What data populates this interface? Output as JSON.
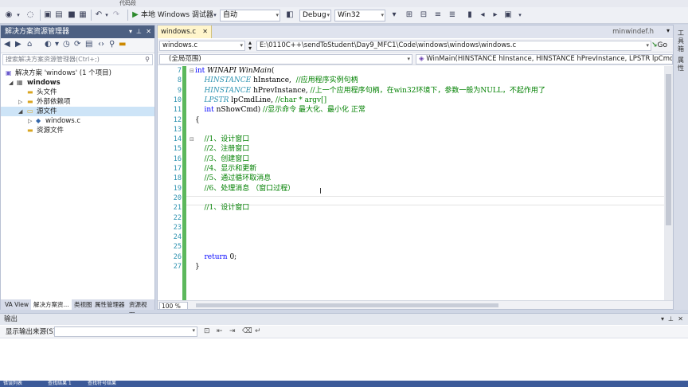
{
  "toolbar": {
    "menu_fragment": "代码段",
    "debug_target": "本地 Windows 调试器",
    "mode_combo": "自动",
    "config_combo": "Debug",
    "platform_combo": "Win32"
  },
  "solution_explorer": {
    "title": "解决方案资源管理器",
    "search_placeholder": "搜索解决方案资源管理器(Ctrl+;)",
    "tree": [
      {
        "label": "解决方案 'windows' (1 个项目)",
        "icon": "solution-icon"
      },
      {
        "label": "windows",
        "icon": "project-icon"
      },
      {
        "label": "头文件",
        "icon": "folder-icon"
      },
      {
        "label": "外部依赖项",
        "icon": "folder-icon"
      },
      {
        "label": "源文件",
        "icon": "folder-open-icon"
      },
      {
        "label": "windows.c",
        "icon": "c-file-icon"
      },
      {
        "label": "资源文件",
        "icon": "folder-icon"
      }
    ],
    "bottom_tabs": [
      "VA View",
      "解决方案资...",
      "类视图",
      "属性管理器",
      "资源视图"
    ]
  },
  "editor": {
    "active_tab": "windows.c",
    "right_tab_label": "minwindef.h",
    "file_combo": "windows.c",
    "path_combo": "E:\\0110C++\\sendToStudent\\Day9_MFC1\\Code\\windows\\windows\\windows.c",
    "go_label": "Go",
    "scope_combo": "(全局范围)",
    "function_combo": "WinMain(HINSTANCE hInstance, HINSTANCE hPrevInstance, LPSTR lpCmdLine, int nSho",
    "zoom": "100 %",
    "lines": [
      {
        "n": "7",
        "fold": "⊟",
        "html_parts": [
          [
            "kw",
            "int "
          ],
          [
            "fn",
            "WINAPI WinMain"
          ],
          [
            "",
            "("
          ]
        ]
      },
      {
        "n": "8",
        "fold": "",
        "html_parts": [
          [
            "",
            "    "
          ],
          [
            "ty",
            "HINSTANCE"
          ],
          [
            "",
            " hInstance,  "
          ],
          [
            "cm",
            "//应用程序实例句柄"
          ]
        ]
      },
      {
        "n": "9",
        "fold": "",
        "html_parts": [
          [
            "",
            "    "
          ],
          [
            "ty",
            "HINSTANCE"
          ],
          [
            "",
            " hPrevInstance, "
          ],
          [
            "cm",
            "//上一个应用程序句柄，在win32环境下，参数一般为NULL，不起作用了"
          ]
        ]
      },
      {
        "n": "10",
        "fold": "",
        "html_parts": [
          [
            "",
            "    "
          ],
          [
            "ty",
            "LPSTR"
          ],
          [
            "",
            " lpCmdLine, "
          ],
          [
            "cm",
            "//char * argv[]"
          ]
        ]
      },
      {
        "n": "11",
        "fold": "",
        "html_parts": [
          [
            "",
            "    "
          ],
          [
            "kw",
            "int"
          ],
          [
            "",
            " nShowCmd) "
          ],
          [
            "cm",
            "//显示命令 最大化、最小化 正常"
          ]
        ]
      },
      {
        "n": "12",
        "fold": "",
        "html_parts": [
          [
            "",
            "{"
          ]
        ]
      },
      {
        "n": "13",
        "fold": "",
        "html_parts": [
          [
            "",
            ""
          ]
        ]
      },
      {
        "n": "14",
        "fold": "⊟",
        "html_parts": [
          [
            "",
            "    "
          ],
          [
            "cm",
            "//1、设计窗口"
          ]
        ]
      },
      {
        "n": "15",
        "fold": "",
        "html_parts": [
          [
            "",
            "    "
          ],
          [
            "cm",
            "//2、注册窗口"
          ]
        ]
      },
      {
        "n": "16",
        "fold": "",
        "html_parts": [
          [
            "",
            "    "
          ],
          [
            "cm",
            "//3、创建窗口"
          ]
        ]
      },
      {
        "n": "17",
        "fold": "",
        "html_parts": [
          [
            "",
            "    "
          ],
          [
            "cm",
            "//4、显示和更新"
          ]
        ]
      },
      {
        "n": "18",
        "fold": "",
        "html_parts": [
          [
            "",
            "    "
          ],
          [
            "cm",
            "//5、通过循环取消息"
          ]
        ]
      },
      {
        "n": "19",
        "fold": "",
        "html_parts": [
          [
            "",
            "    "
          ],
          [
            "cm",
            "//6、处理消息 （窗口过程）"
          ]
        ]
      },
      {
        "n": "20",
        "fold": "",
        "html_parts": [
          [
            "",
            ""
          ]
        ]
      },
      {
        "n": "21",
        "fold": "",
        "html_parts": [
          [
            "",
            "    "
          ],
          [
            "cm",
            "//1、设计窗口"
          ]
        ]
      },
      {
        "n": "22",
        "fold": "",
        "html_parts": [
          [
            "",
            ""
          ]
        ]
      },
      {
        "n": "23",
        "fold": "",
        "html_parts": [
          [
            "",
            ""
          ]
        ]
      },
      {
        "n": "24",
        "fold": "",
        "html_parts": [
          [
            "",
            ""
          ]
        ]
      },
      {
        "n": "25",
        "fold": "",
        "html_parts": [
          [
            "",
            ""
          ]
        ]
      },
      {
        "n": "26",
        "fold": "",
        "html_parts": [
          [
            "",
            "    "
          ],
          [
            "kw",
            "return"
          ],
          [
            "",
            " 0;"
          ]
        ]
      },
      {
        "n": "27",
        "fold": "",
        "html_parts": [
          [
            "",
            "}"
          ]
        ]
      }
    ]
  },
  "right_strip": {
    "tabs": [
      "工具箱",
      "属性"
    ]
  },
  "output": {
    "title": "输出",
    "source_label": "显示输出来源(S):",
    "source_value": ""
  },
  "status": {
    "items": [
      "错误列表",
      "查找结果 1",
      "查找符号结果"
    ]
  }
}
